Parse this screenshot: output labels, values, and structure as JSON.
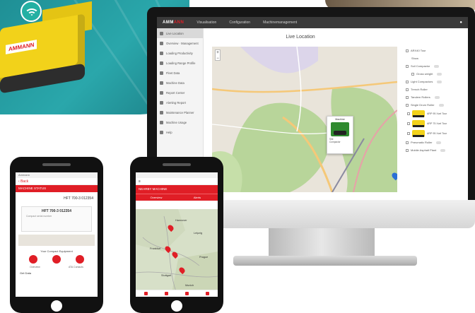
{
  "colors": {
    "brand_red": "#e01e26",
    "teal": "#2aa7ab",
    "paver_yellow": "#f2d21a"
  },
  "banner": {
    "machine_logo": "AMMANN",
    "badge_icon": "wifi-icon"
  },
  "desktop": {
    "logo_prefix": "AMM",
    "logo_suffix": "ANN",
    "nav": [
      "Visualisation",
      "Configuration",
      "Machinemanagement"
    ],
    "page_title": "Live Location",
    "zoom": [
      "+",
      "−"
    ],
    "sidebar": [
      "Live Location",
      "Overview · Management",
      "Loading Productivity",
      "Loading Range Profile",
      "Fleet Data",
      "Machine Data",
      "Report Center",
      "Alerting Report",
      "Maintenance Planner",
      "Machine Usage",
      "Help"
    ],
    "popup": {
      "title": "Machine",
      "line1": "Site",
      "line2": "Compactor"
    },
    "panel": {
      "rows": [
        "ARX40 Tour",
        "Show",
        "Soil Compactor",
        "Gross weight",
        "Light Compactors",
        "Trench Roller",
        "Tandem Rollers",
        "Single Drum Roller"
      ],
      "machines": [
        "ARP 95 Xcel Tour",
        "ARP 75 Xcel Tour",
        "ARP 95 Xcel Tour"
      ],
      "tail": [
        "Pneumatic Roller",
        "Mobile Asphalt Plant"
      ]
    }
  },
  "phone1": {
    "status": "Ammann",
    "back": "Back",
    "section": "MACHINE STATUS",
    "reg": "HFT 700-3 012354",
    "card_id": "HFT 700-3 012354",
    "card_text": "Compact serial number",
    "info": "Your Compact Equipment",
    "labels": [
      "Overview",
      "ATA Contacts"
    ],
    "footer": "Get Data"
  },
  "phone2": {
    "search": "≡",
    "section": "NEARBY MACHINE",
    "tabs": [
      "Overview",
      "Alerts"
    ],
    "cities": [
      "Hannover",
      "Leipzig",
      "Frankfurt",
      "Stuttgart",
      "Munich",
      "Prague"
    ]
  }
}
